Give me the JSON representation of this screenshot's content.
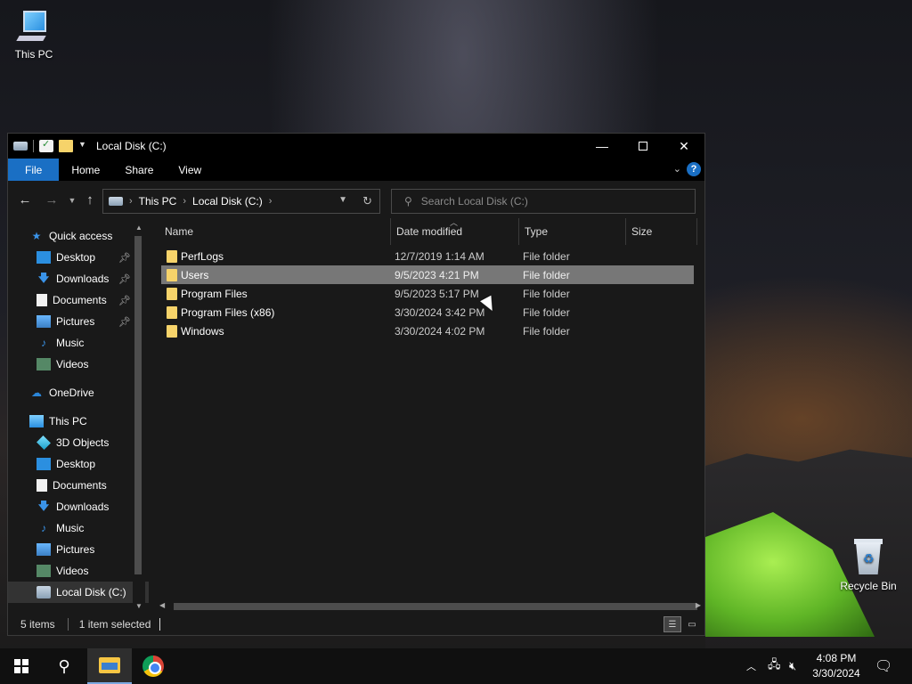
{
  "desktop": {
    "icons": [
      {
        "label": "This PC"
      },
      {
        "label": "Recycle Bin"
      }
    ]
  },
  "window": {
    "title": "Local Disk (C:)",
    "controls": {
      "minimize": "—",
      "maximize": "",
      "close": "✕"
    },
    "ribbon_tabs": [
      "File",
      "Home",
      "Share",
      "View"
    ],
    "address": {
      "crumbs": [
        "This PC",
        "Local Disk (C:)"
      ],
      "separator": "›"
    },
    "search": {
      "placeholder": "Search Local Disk (C:)"
    },
    "nav_pane": {
      "quick_access": {
        "label": "Quick access"
      },
      "quick_items": [
        {
          "label": "Desktop",
          "pinned": true
        },
        {
          "label": "Downloads",
          "pinned": true
        },
        {
          "label": "Documents",
          "pinned": true
        },
        {
          "label": "Pictures",
          "pinned": true
        },
        {
          "label": "Music",
          "pinned": false
        },
        {
          "label": "Videos",
          "pinned": false
        }
      ],
      "onedrive": {
        "label": "OneDrive"
      },
      "this_pc": {
        "label": "This PC"
      },
      "pc_items": [
        {
          "label": "3D Objects"
        },
        {
          "label": "Desktop"
        },
        {
          "label": "Documents"
        },
        {
          "label": "Downloads"
        },
        {
          "label": "Music"
        },
        {
          "label": "Pictures"
        },
        {
          "label": "Videos"
        },
        {
          "label": "Local Disk (C:)"
        }
      ]
    },
    "columns": {
      "name": "Name",
      "date": "Date modified",
      "type": "Type",
      "size": "Size"
    },
    "files": [
      {
        "name": "PerfLogs",
        "date": "12/7/2019 1:14 AM",
        "type": "File folder"
      },
      {
        "name": "Users",
        "date": "9/5/2023 4:21 PM",
        "type": "File folder",
        "selected": true
      },
      {
        "name": "Program Files",
        "date": "9/5/2023 5:17 PM",
        "type": "File folder"
      },
      {
        "name": "Program Files (x86)",
        "date": "3/30/2024 3:42 PM",
        "type": "File folder"
      },
      {
        "name": "Windows",
        "date": "3/30/2024 4:02 PM",
        "type": "File folder"
      }
    ],
    "status": {
      "items": "5 items",
      "selected": "1 item selected"
    }
  },
  "taskbar": {
    "time": "4:08 PM",
    "date": "3/30/2024"
  },
  "colors": {
    "accent": "#1a6fc4",
    "folder": "#f6d36a",
    "selection": "#777777"
  }
}
